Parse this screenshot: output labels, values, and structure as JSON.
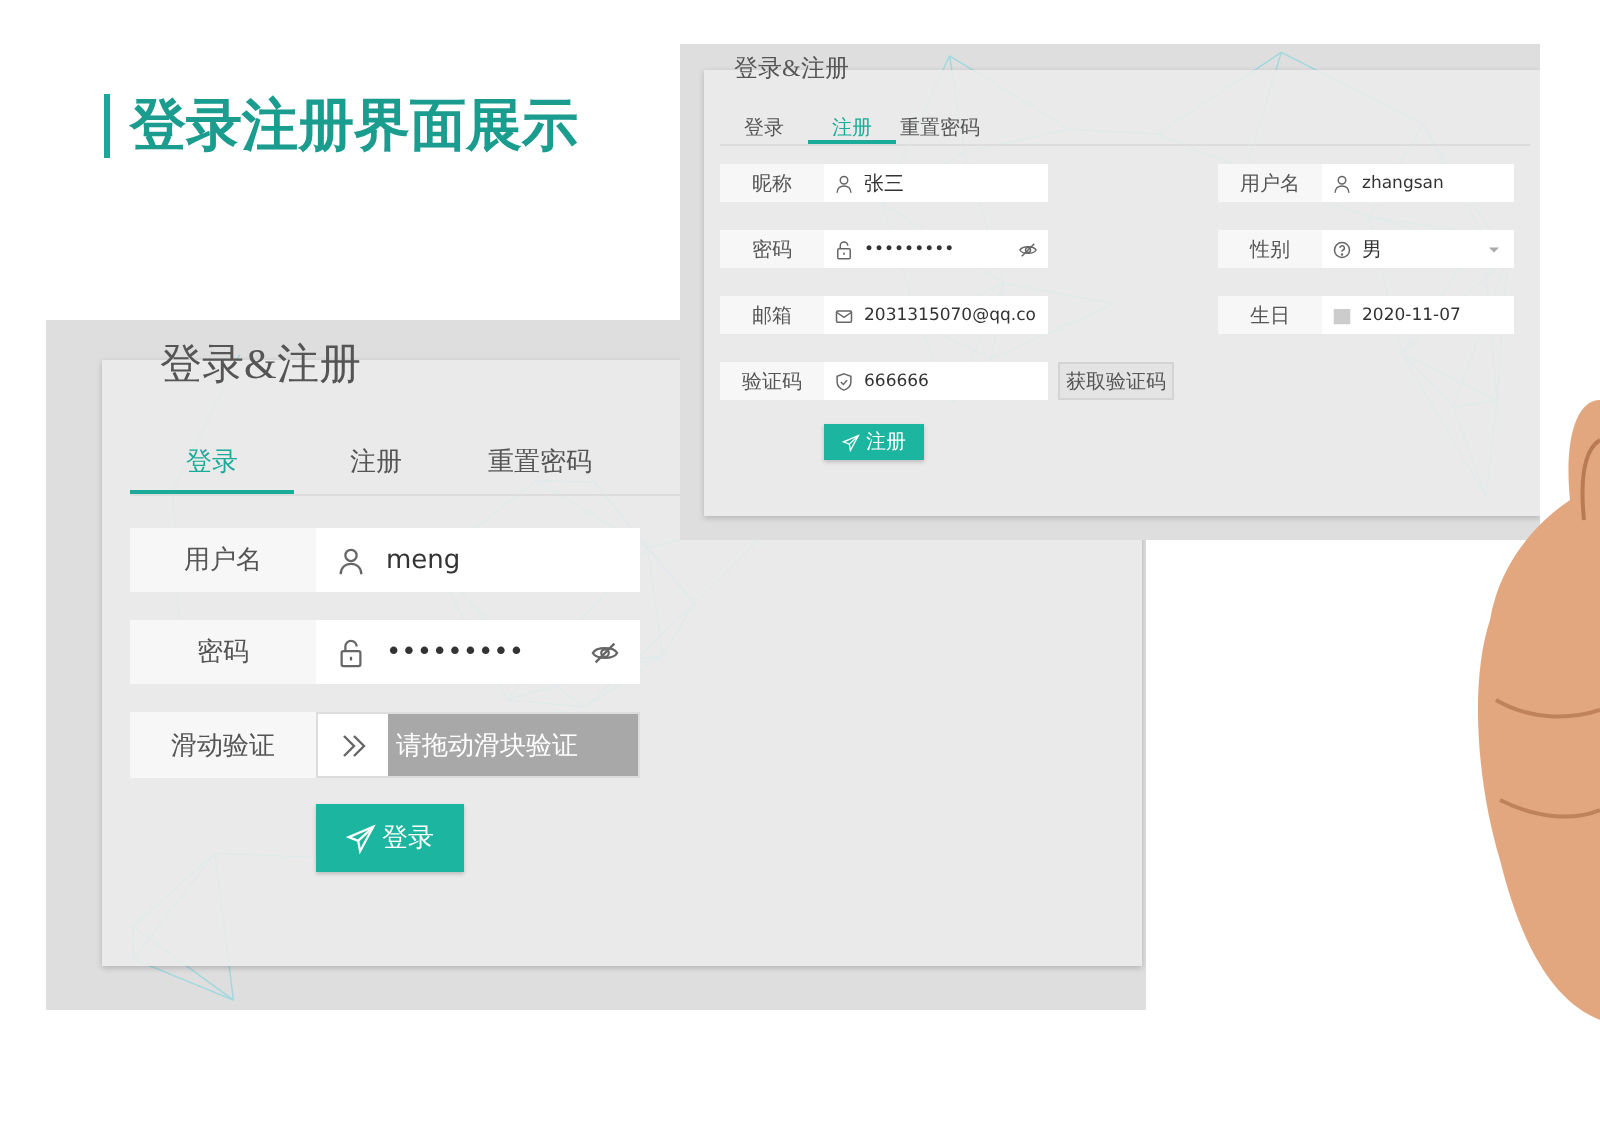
{
  "slide": {
    "title": "登录注册界面展示"
  },
  "login_screen": {
    "heading": "登录&注册",
    "tabs": [
      {
        "label": "登录",
        "selected": true
      },
      {
        "label": "注册",
        "selected": false
      },
      {
        "label": "重置密码",
        "selected": false
      }
    ],
    "fields": [
      {
        "kind": "text",
        "label": "用户名",
        "value": "meng"
      },
      {
        "kind": "password",
        "label": "密码",
        "value": "•••••••••"
      },
      {
        "kind": "slider",
        "label": "滑动验证",
        "placeholder": "请拖动滑块验证"
      }
    ],
    "submit": "登录"
  },
  "register_screen": {
    "heading": "登录&注册",
    "tabs": [
      {
        "label": "登录",
        "selected": false
      },
      {
        "label": "注册",
        "selected": true
      },
      {
        "label": "重置密码",
        "selected": false
      }
    ],
    "left_fields": [
      {
        "kind": "text",
        "label": "昵称",
        "value": "张三"
      },
      {
        "kind": "password",
        "label": "密码",
        "value": "•••••••••"
      },
      {
        "kind": "email",
        "label": "邮箱",
        "value": "2031315070@qq.co"
      },
      {
        "kind": "code",
        "label": "验证码",
        "value": "666666",
        "button": "获取验证码"
      }
    ],
    "right_fields": [
      {
        "kind": "text",
        "label": "用户名",
        "value": "zhangsan"
      },
      {
        "kind": "select",
        "label": "性别",
        "value": "男"
      },
      {
        "kind": "date",
        "label": "生日",
        "value": "2020-11-07"
      }
    ],
    "submit": "注册"
  }
}
